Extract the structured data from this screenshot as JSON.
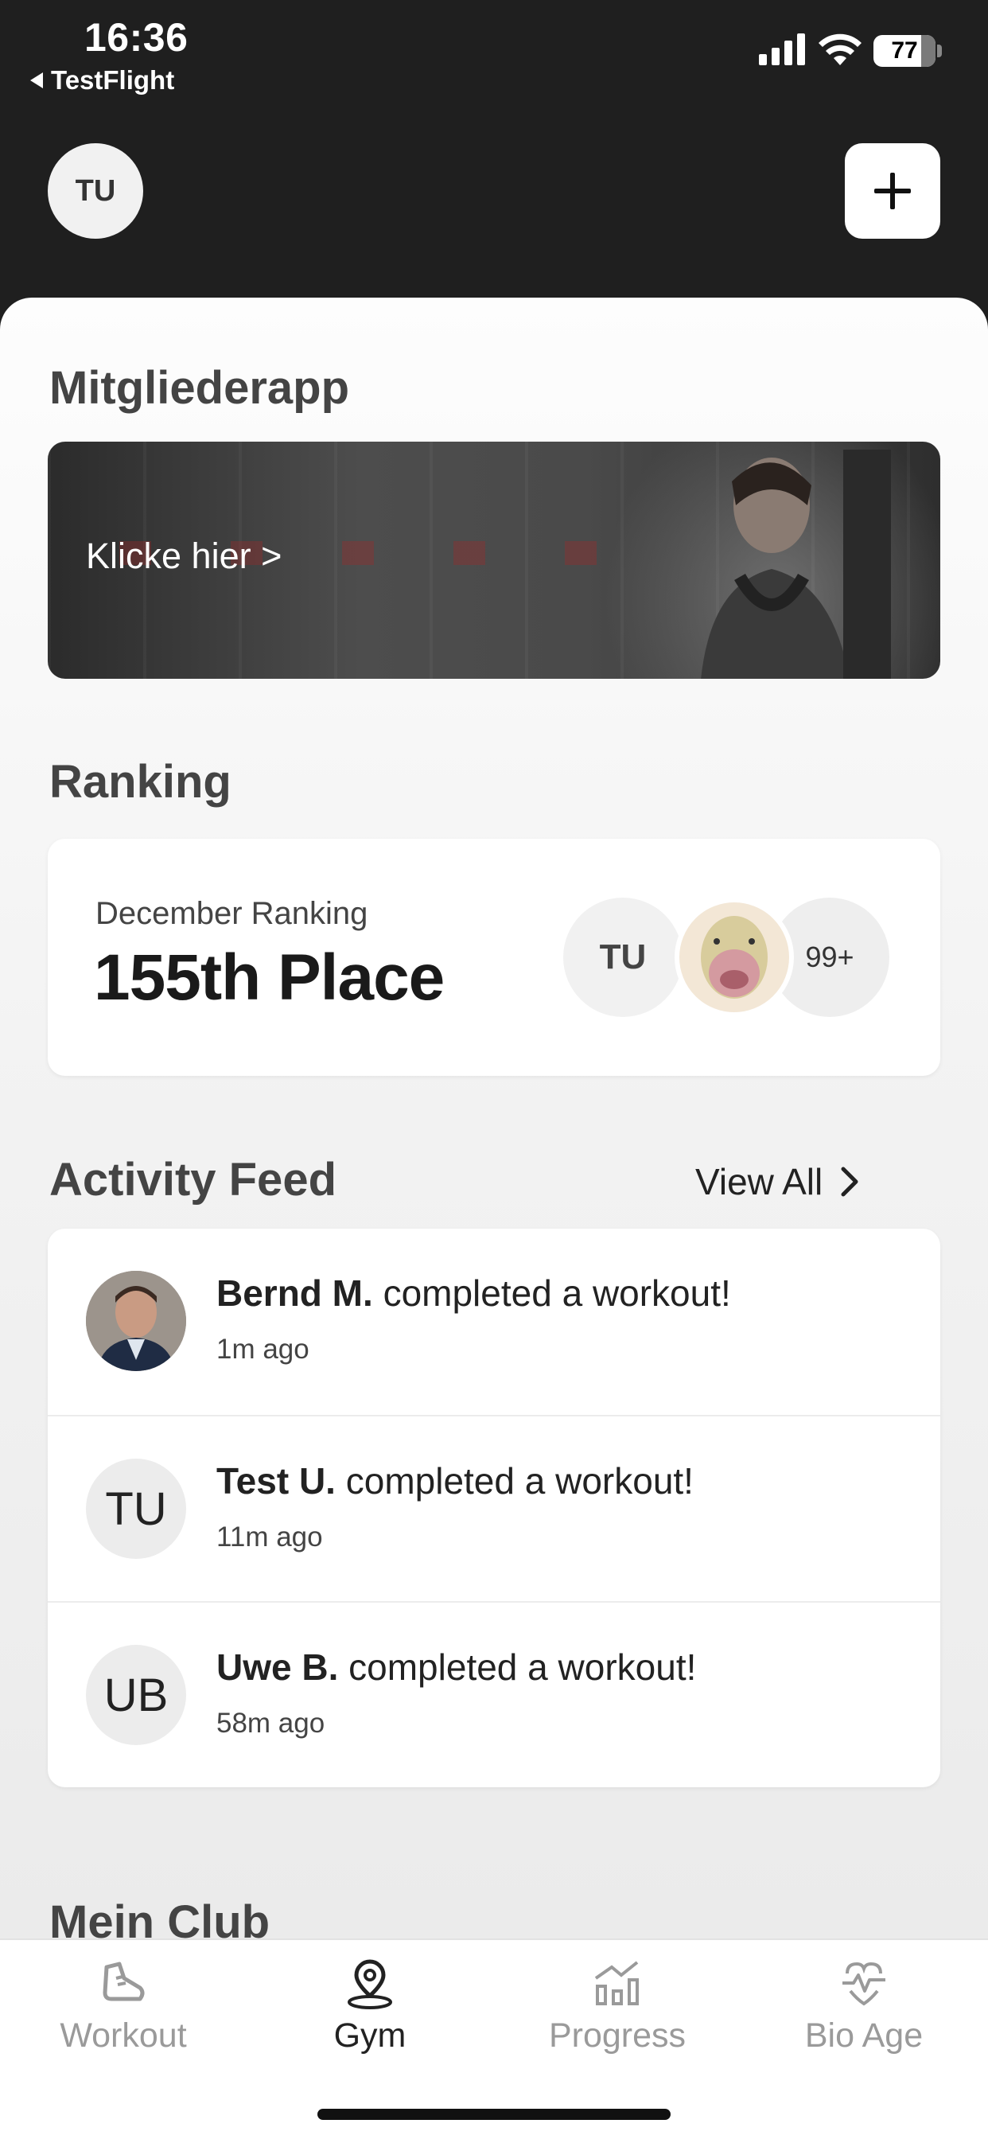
{
  "status_bar": {
    "time": "16:36",
    "back_app": "TestFlight",
    "battery": "77",
    "battery_level": 0.77
  },
  "header": {
    "avatar_initials": "TU",
    "add_icon": "plus-icon"
  },
  "sections": {
    "members": {
      "title": "Mitgliederapp",
      "banner_label": "Klicke hier >"
    },
    "ranking": {
      "title": "Ranking",
      "subtitle": "December Ranking",
      "place": "155th Place",
      "avatars": [
        "TU",
        "duck-avatar",
        "99+"
      ]
    },
    "activity": {
      "title": "Activity Feed",
      "view_all": "View All",
      "items": [
        {
          "name": "Bernd M.",
          "action": "completed a workout!",
          "time": "1m ago",
          "avatar": "photo"
        },
        {
          "name": "Test U.",
          "action": "completed a workout!",
          "time": "11m ago",
          "avatar": "TU"
        },
        {
          "name": "Uwe B.",
          "action": "completed a workout!",
          "time": "58m ago",
          "avatar": "UB"
        }
      ]
    },
    "club": {
      "title": "Mein Club"
    }
  },
  "tabbar": {
    "tabs": [
      {
        "label": "Workout",
        "icon": "shoe-icon",
        "active": false
      },
      {
        "label": "Gym",
        "icon": "location-pin-icon",
        "active": true
      },
      {
        "label": "Progress",
        "icon": "chart-icon",
        "active": false
      },
      {
        "label": "Bio Age",
        "icon": "heart-pulse-icon",
        "active": false
      }
    ]
  },
  "colors": {
    "header_bg": "#1f1f1f",
    "text_primary": "#222222",
    "tab_inactive": "#9a9a9a"
  }
}
